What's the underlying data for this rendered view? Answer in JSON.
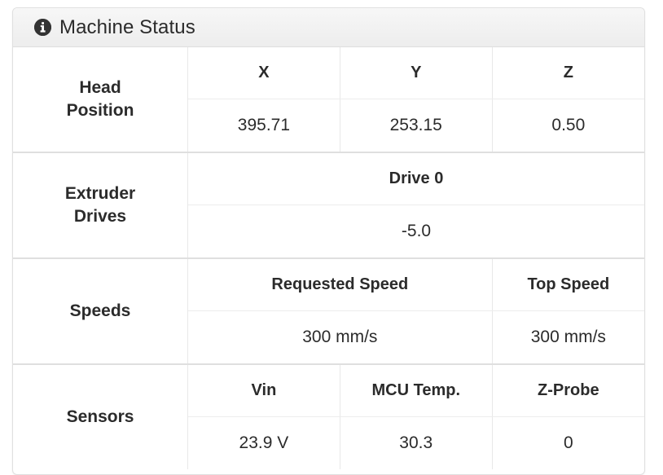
{
  "panel": {
    "title": "Machine Status",
    "icon": "info-icon"
  },
  "sections": {
    "head_position": {
      "label_line1": "Head",
      "label_line2": "Position",
      "headers": [
        "X",
        "Y",
        "Z"
      ],
      "values": [
        "395.71",
        "253.15",
        "0.50"
      ]
    },
    "extruder_drives": {
      "label_line1": "Extruder",
      "label_line2": "Drives",
      "headers": [
        "Drive 0"
      ],
      "values": [
        "-5.0"
      ]
    },
    "speeds": {
      "label_line1": "Speeds",
      "label_line2": "",
      "headers": [
        "Requested Speed",
        "Top Speed"
      ],
      "values": [
        "300 mm/s",
        "300 mm/s"
      ]
    },
    "sensors": {
      "label_line1": "Sensors",
      "label_line2": "",
      "headers": [
        "Vin",
        "MCU Temp.",
        "Z-Probe"
      ],
      "values": [
        "23.9 V",
        "30.3",
        "0"
      ]
    }
  },
  "colors": {
    "text": "#2b2b2b",
    "border": "#e0e0e0",
    "section_divider": "#dfdfdf",
    "header_gradient_top": "#f7f7f7",
    "header_gradient_bottom": "#ededed",
    "icon_fill": "#333333"
  }
}
